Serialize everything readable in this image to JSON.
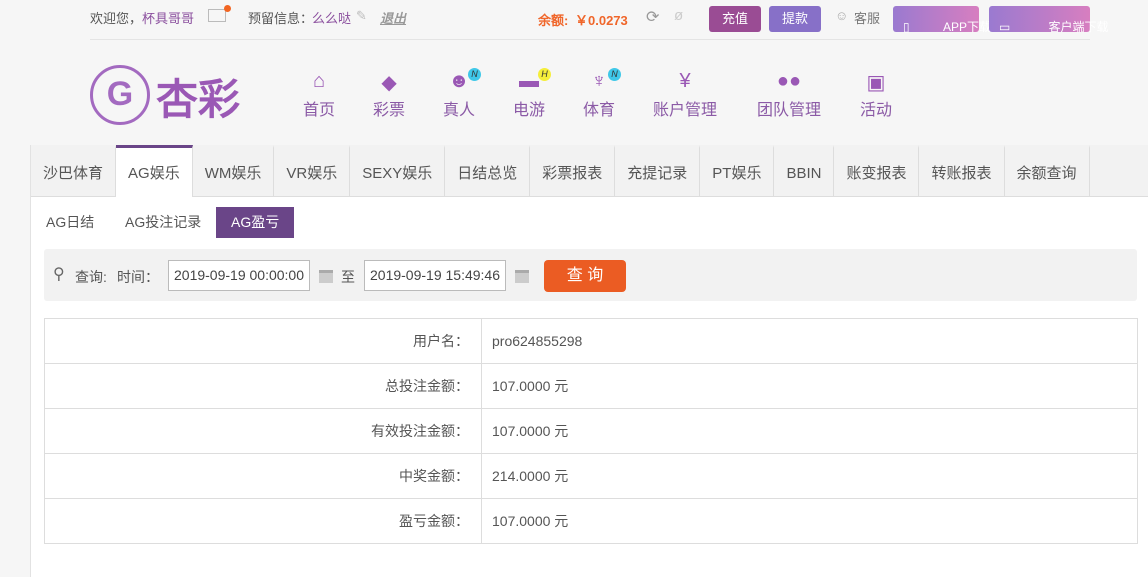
{
  "topbar": {
    "welcome": "欢迎您，",
    "username": "杯具哥哥",
    "reserved_label": "预留信息：",
    "reserved_value": "么么哒",
    "logout": "退出",
    "balance_label": "余额:",
    "balance_value": "￥0.0273",
    "deposit": "充值",
    "withdraw": "提款",
    "service": "客服",
    "app_download": "APP下载",
    "client_download": "客户端下载"
  },
  "logo": {
    "text": "杏彩"
  },
  "nav": [
    {
      "label": "首页"
    },
    {
      "label": "彩票"
    },
    {
      "label": "真人",
      "badge": "N"
    },
    {
      "label": "电游",
      "badge": "H"
    },
    {
      "label": "体育",
      "badge": "N"
    },
    {
      "label": "账户管理"
    },
    {
      "label": "团队管理"
    },
    {
      "label": "活动"
    }
  ],
  "tabs": [
    "沙巴体育",
    "AG娱乐",
    "WM娱乐",
    "VR娱乐",
    "SEXY娱乐",
    "日结总览",
    "彩票报表",
    "充提记录",
    "PT娱乐",
    "BBIN",
    "账变报表",
    "转账报表",
    "余额查询"
  ],
  "subtabs": [
    "AG日结",
    "AG投注记录",
    "AG盈亏"
  ],
  "query": {
    "label": "查询:",
    "time_label": "时间：",
    "start": "2019-09-19 00:00:00",
    "to": "至",
    "end": "2019-09-19 15:49:46",
    "button": "查 询"
  },
  "rows": [
    {
      "label": "用户名：",
      "value": "pro624855298"
    },
    {
      "label": "总投注金额：",
      "value": "107.0000 元"
    },
    {
      "label": "有效投注金额：",
      "value": "107.0000 元"
    },
    {
      "label": "中奖金额：",
      "value": "214.0000 元"
    },
    {
      "label": "盈亏金额：",
      "value": "107.0000 元"
    }
  ]
}
